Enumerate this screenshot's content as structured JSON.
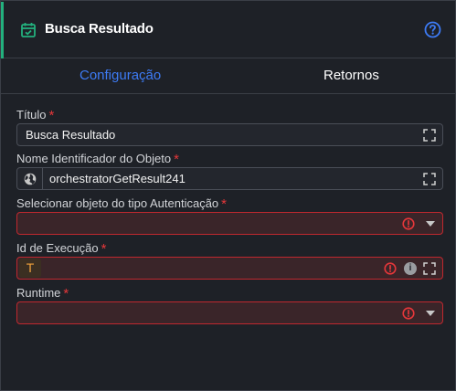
{
  "header": {
    "title": "Busca Resultado",
    "accent_color": "#23b07d",
    "icon": "calendar-check-icon",
    "help_icon": "help-circle-icon"
  },
  "tabs": [
    {
      "label": "Configuração",
      "active": true
    },
    {
      "label": "Retornos",
      "active": false
    }
  ],
  "fields": {
    "titulo": {
      "label": "Título",
      "required_mark": "*",
      "value": "Busca Resultado"
    },
    "nome_objeto": {
      "label": "Nome Identificador do Objeto",
      "required_mark": "*",
      "value": "orchestratorGetResult241"
    },
    "objeto_autenticacao": {
      "label": "Selecionar objeto do tipo Autenticação",
      "required_mark": "*",
      "value": ""
    },
    "id_execucao": {
      "label": "Id de Execução",
      "required_mark": "*",
      "value": "",
      "type_badge": "T"
    },
    "runtime": {
      "label": "Runtime",
      "required_mark": "*",
      "value": ""
    }
  },
  "colors": {
    "active_tab": "#3d7bf5",
    "error": "#e5373a",
    "required": "#e5373a",
    "type_badge": "#f0a23b"
  }
}
